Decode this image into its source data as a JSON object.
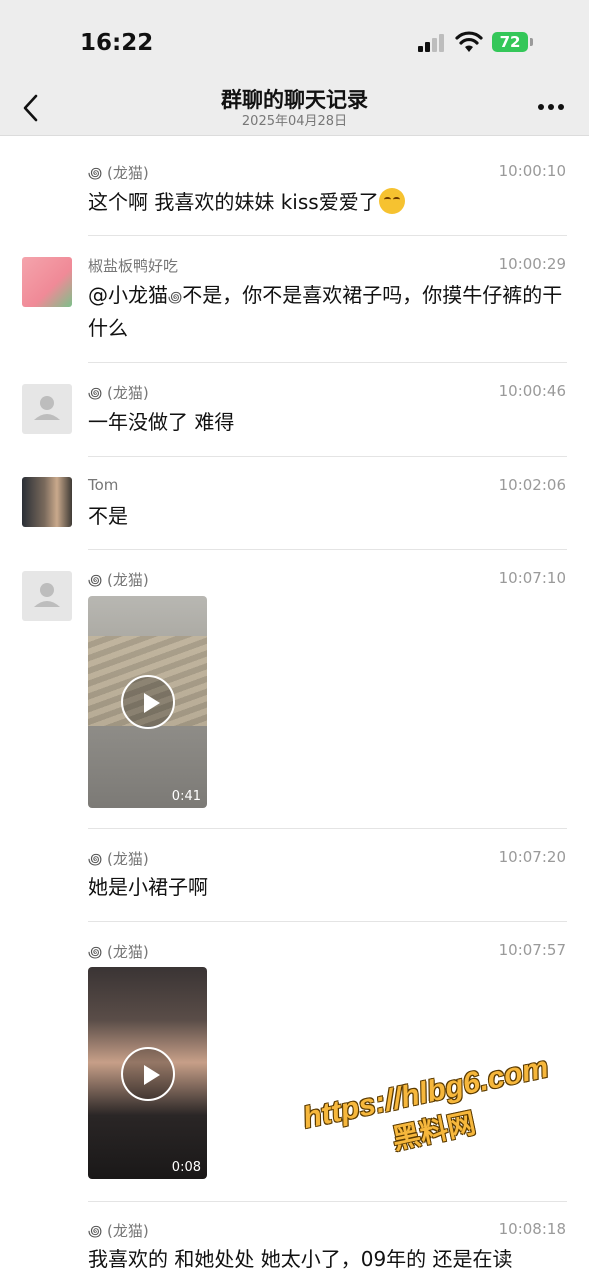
{
  "status_bar": {
    "time": "16:22",
    "battery": "72"
  },
  "nav": {
    "title": "群聊的聊天记录",
    "subtitle": "2025年04月28日"
  },
  "messages": [
    {
      "sender": "(龙猫)",
      "time": "10:00:10",
      "text": "这个啊  我喜欢的妹妹  kiss爱爱了"
    },
    {
      "sender": "椒盐板鸭好吃",
      "time": "10:00:29",
      "text_a": "@小龙猫",
      "text_b": "不是，你不是喜欢裙子吗，你摸牛仔裤的干什么"
    },
    {
      "sender": "(龙猫)",
      "time": "10:00:46",
      "text": "一年没做了 难得"
    },
    {
      "sender": "Tom",
      "time": "10:02:06",
      "text": "不是"
    },
    {
      "sender": "(龙猫)",
      "time": "10:07:10",
      "video_duration": "0:41"
    },
    {
      "sender": "(龙猫)",
      "time": "10:07:20",
      "text": "她是小裙子啊"
    },
    {
      "sender": "(龙猫)",
      "time": "10:07:57",
      "video_duration": "0:08"
    },
    {
      "sender": "(龙猫)",
      "time": "10:08:18",
      "text": "我喜欢的  和她处处 她太小了，09年的 还是在读"
    }
  ],
  "watermark": {
    "url": "https://hlbg6.com",
    "name": "黑料网"
  },
  "icons": {
    "back": "chevron-left-icon",
    "more": "more-dots-icon",
    "play": "play-icon"
  }
}
